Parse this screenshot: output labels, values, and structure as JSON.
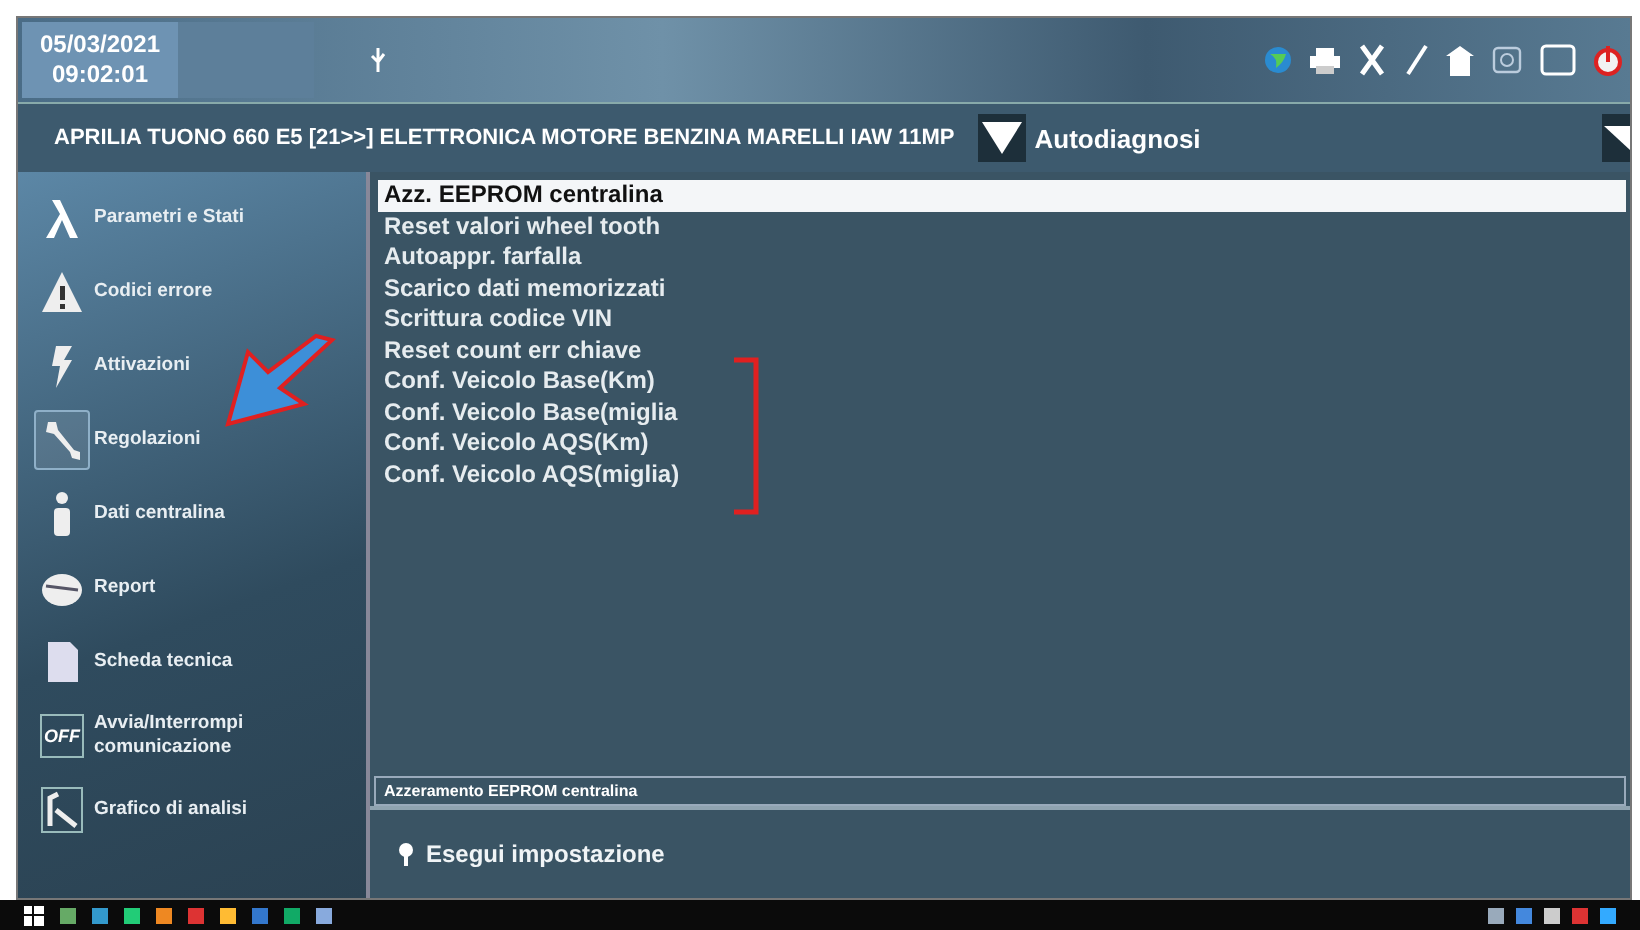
{
  "header": {
    "date": "05/03/2021",
    "time": "09:02:01"
  },
  "vehicle_bar": {
    "vehicle": "APRILIA TUONO  660 E5  [21>>] ELETTRONICA MOTORE BENZINA MARELLI IAW 11MP",
    "mode": "Autodiagnosi"
  },
  "sidebar": {
    "items": [
      {
        "kind": "lambda",
        "label": "Parametri e Stati",
        "selected": false
      },
      {
        "kind": "warning",
        "label": "Codici errore",
        "selected": false
      },
      {
        "kind": "bolt",
        "label": "Attivazioni",
        "selected": false
      },
      {
        "kind": "wrench",
        "label": "Regolazioni",
        "selected": true
      },
      {
        "kind": "info",
        "label": "Dati centralina",
        "selected": false
      },
      {
        "kind": "report",
        "label": "Report",
        "selected": false
      },
      {
        "kind": "sheet",
        "label": "Scheda tecnica",
        "selected": false
      },
      {
        "kind": "off",
        "label": "Avvia/Interrompi comunicazione",
        "icon_text": "OFF",
        "selected": false
      },
      {
        "kind": "graph",
        "label": "Grafico di analisi",
        "selected": false
      }
    ]
  },
  "list": {
    "items": [
      {
        "label": "Azz. EEPROM centralina",
        "selected": true
      },
      {
        "label": "Reset valori wheel tooth",
        "selected": false
      },
      {
        "label": "Autoappr. farfalla",
        "selected": false
      },
      {
        "label": "Scarico dati memorizzati",
        "selected": false
      },
      {
        "label": "Scrittura codice VIN",
        "selected": false
      },
      {
        "label": "Reset count err chiave",
        "selected": false
      },
      {
        "label": "Conf. Veicolo Base(Km)",
        "selected": false
      },
      {
        "label": "Conf. Veicolo Base(miglia",
        "selected": false
      },
      {
        "label": "Conf. Veicolo AQS(Km)",
        "selected": false
      },
      {
        "label": "Conf. Veicolo AQS(miglia)",
        "selected": false
      }
    ]
  },
  "description": "Azzeramento EEPROM centralina",
  "action_button": "Esegui impostazione"
}
